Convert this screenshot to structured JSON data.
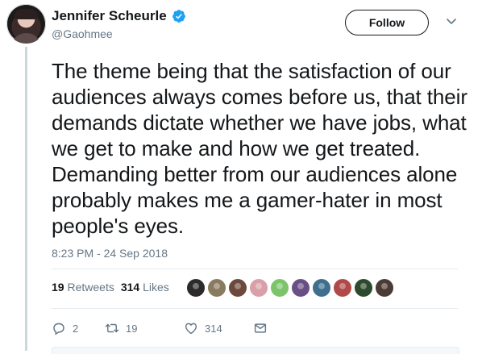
{
  "tweet": {
    "author_name": "Jennifer Scheurle",
    "handle": "@Gaohmee",
    "text": "The theme being that the satisfaction of our audiences always comes before us, that their demands dictate whether we have jobs, what we get to make and how we get treated. Demanding better from our audiences alone probably makes me a gamer-hater in most people's eyes.",
    "timestamp": "8:23 PM - 24 Sep 2018"
  },
  "follow_button": {
    "label": "Follow"
  },
  "stats": {
    "retweets_count": "19",
    "retweets_label": "Retweets",
    "likes_count": "314",
    "likes_label": "Likes"
  },
  "likers": [
    {
      "name": "liker-avatar-1",
      "color": "#2c2a2a"
    },
    {
      "name": "liker-avatar-2",
      "color": "#8a7a5f"
    },
    {
      "name": "liker-avatar-3",
      "color": "#6b4a3d"
    },
    {
      "name": "liker-avatar-4",
      "color": "#d9a0a8"
    },
    {
      "name": "liker-avatar-5",
      "color": "#7cc46a"
    },
    {
      "name": "liker-avatar-6",
      "color": "#6a4f87"
    },
    {
      "name": "liker-avatar-7",
      "color": "#3e6f8f"
    },
    {
      "name": "liker-avatar-8",
      "color": "#b04a4a"
    },
    {
      "name": "liker-avatar-9",
      "color": "#2e4a2e"
    },
    {
      "name": "liker-avatar-10",
      "color": "#4b3b35"
    }
  ],
  "actions": {
    "reply_count": "2",
    "retweet_count": "19",
    "like_count": "314"
  },
  "colors": {
    "verified_blue": "#1da1f2",
    "muted_text": "#657786",
    "divider": "#e6ecf0",
    "text": "#14171a"
  }
}
